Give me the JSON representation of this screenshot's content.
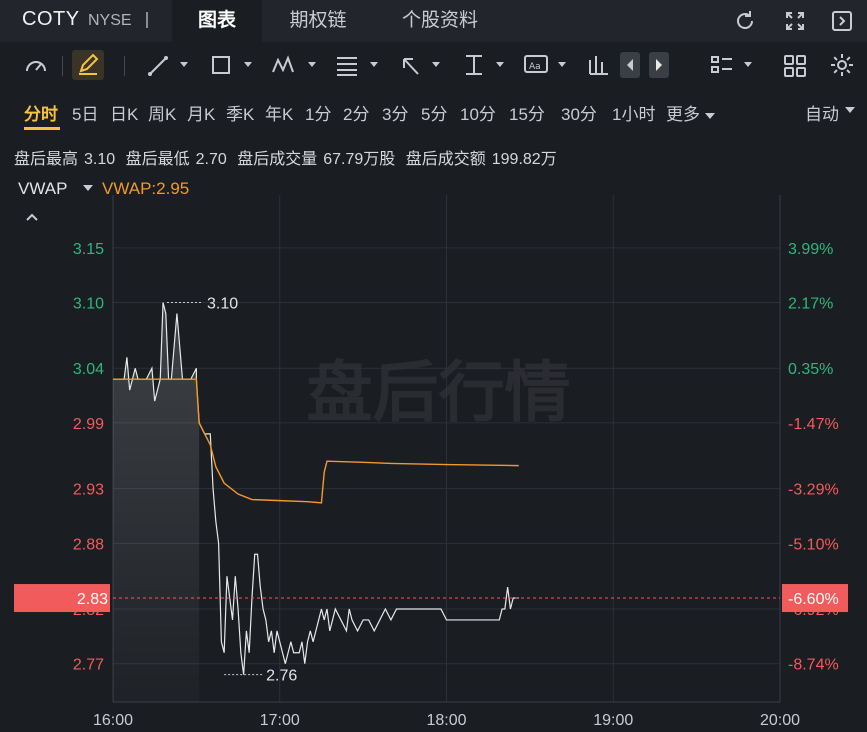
{
  "header": {
    "ticker": "COTY",
    "exchange": "NYSE",
    "tabs": [
      {
        "label": "图表",
        "active": true
      },
      {
        "label": "期权链",
        "active": false
      },
      {
        "label": "个股资料",
        "active": false
      }
    ],
    "icons": [
      "refresh-icon",
      "fullscreen-icon",
      "sidebar-toggle-icon"
    ]
  },
  "toolbar": {
    "icons": [
      "gauge-icon",
      "pen-icon",
      "trendline-icon",
      "rectangle-icon",
      "pattern-icon",
      "fibonacci-icon",
      "arrow-icon",
      "text-height-icon",
      "annotation-icon",
      "candle-bars-icon",
      "prev-arrow-icon",
      "next-arrow-icon",
      "list-settings-icon",
      "grid-layout-icon",
      "settings-icon"
    ],
    "accent": "#f5c242"
  },
  "periods": {
    "items": [
      "分时",
      "5日",
      "日K",
      "周K",
      "月K",
      "季K",
      "年K",
      "1分",
      "2分",
      "3分",
      "5分",
      "10分",
      "15分",
      "30分",
      "1小时",
      "更多"
    ],
    "active": "分时",
    "mode": "自动"
  },
  "stats": {
    "high_label": "盘后最高",
    "high": "3.10",
    "low_label": "盘后最低",
    "low": "2.70",
    "volume_label": "盘后成交量",
    "volume": "67.79万股",
    "amount_label": "盘后成交额",
    "amount": "199.82万"
  },
  "indicator": {
    "name": "VWAP",
    "value_text": "VWAP:2.95",
    "color": "#f19a2a"
  },
  "chart_data": {
    "type": "line",
    "watermark": "盘后行情",
    "x_ticks": [
      "16:00",
      "17:00",
      "18:00",
      "19:00",
      "20:00"
    ],
    "xlim": [
      "16:00",
      "20:00"
    ],
    "ylim": [
      2.735,
      3.18
    ],
    "y_ticks_left": [
      "3.15",
      "3.10",
      "3.04",
      "2.99",
      "2.93",
      "2.88",
      "2.82",
      "2.77"
    ],
    "y_ticks_right": [
      "3.99%",
      "2.17%",
      "0.35%",
      "-1.47%",
      "-3.29%",
      "-5.10%",
      "-6.92%",
      "-8.74%"
    ],
    "y_tick_values": [
      3.15,
      3.1,
      3.04,
      2.99,
      2.93,
      2.88,
      2.82,
      2.77
    ],
    "reference_price": 3.03,
    "up_color": "#2cb87b",
    "down_color": "#f25b5b",
    "current_price": {
      "label": "2.83",
      "pct": "-6.60%",
      "value": 2.83
    },
    "max_annotation": {
      "time": "16:18",
      "value": 3.1,
      "label": "3.10"
    },
    "min_annotation": {
      "time": "16:40",
      "value": 2.76,
      "label": "2.76"
    },
    "series": [
      {
        "name": "price",
        "color": "#e8e8e8",
        "points": [
          [
            "16:00",
            3.03
          ],
          [
            "16:04",
            3.03
          ],
          [
            "16:05",
            3.05
          ],
          [
            "16:06",
            3.02
          ],
          [
            "16:08",
            3.04
          ],
          [
            "16:09",
            3.03
          ],
          [
            "16:10",
            3.03
          ],
          [
            "16:12",
            3.03
          ],
          [
            "16:14",
            3.04
          ],
          [
            "16:15",
            3.01
          ],
          [
            "16:17",
            3.03
          ],
          [
            "16:18",
            3.1
          ],
          [
            "16:19",
            3.09
          ],
          [
            "16:20",
            3.03
          ],
          [
            "16:21",
            3.03
          ],
          [
            "16:23",
            3.09
          ],
          [
            "16:24",
            3.06
          ],
          [
            "16:25",
            3.03
          ],
          [
            "16:28",
            3.03
          ],
          [
            "16:30",
            3.04
          ],
          [
            "16:30",
            3.03
          ],
          [
            "16:31",
            2.99
          ],
          [
            "16:33",
            2.98
          ],
          [
            "16:35",
            2.98
          ],
          [
            "16:36",
            2.93
          ],
          [
            "16:37",
            2.9
          ],
          [
            "16:38",
            2.88
          ],
          [
            "16:39",
            2.79
          ],
          [
            "16:40",
            2.78
          ],
          [
            "16:41",
            2.85
          ],
          [
            "16:42",
            2.83
          ],
          [
            "16:43",
            2.81
          ],
          [
            "16:44",
            2.85
          ],
          [
            "16:45",
            2.82
          ],
          [
            "16:46",
            2.78
          ],
          [
            "16:47",
            2.76
          ],
          [
            "16:48",
            2.8
          ],
          [
            "16:49",
            2.78
          ],
          [
            "16:50",
            2.83
          ],
          [
            "16:51",
            2.87
          ],
          [
            "16:52",
            2.87
          ],
          [
            "16:53",
            2.84
          ],
          [
            "16:54",
            2.82
          ],
          [
            "16:55",
            2.81
          ],
          [
            "16:56",
            2.79
          ],
          [
            "16:57",
            2.8
          ],
          [
            "16:58",
            2.78
          ],
          [
            "16:59",
            2.8
          ],
          [
            "17:00",
            2.79
          ],
          [
            "17:01",
            2.78
          ],
          [
            "17:02",
            2.77
          ],
          [
            "17:03",
            2.78
          ],
          [
            "17:04",
            2.79
          ],
          [
            "17:05",
            2.78
          ],
          [
            "17:07",
            2.78
          ],
          [
            "17:08",
            2.79
          ],
          [
            "17:09",
            2.77
          ],
          [
            "17:10",
            2.79
          ],
          [
            "17:11",
            2.8
          ],
          [
            "17:12",
            2.79
          ],
          [
            "17:13",
            2.8
          ],
          [
            "17:14",
            2.81
          ],
          [
            "17:15",
            2.82
          ],
          [
            "17:16",
            2.81
          ],
          [
            "17:17",
            2.82
          ],
          [
            "17:18",
            2.8
          ],
          [
            "17:19",
            2.81
          ],
          [
            "17:20",
            2.82
          ],
          [
            "17:22",
            2.81
          ],
          [
            "17:24",
            2.8
          ],
          [
            "17:25",
            2.82
          ],
          [
            "17:26",
            2.81
          ],
          [
            "17:28",
            2.8
          ],
          [
            "17:30",
            2.81
          ],
          [
            "17:32",
            2.81
          ],
          [
            "17:34",
            2.8
          ],
          [
            "17:36",
            2.81
          ],
          [
            "17:38",
            2.82
          ],
          [
            "17:40",
            2.81
          ],
          [
            "17:42",
            2.82
          ],
          [
            "17:45",
            2.82
          ],
          [
            "17:48",
            2.82
          ],
          [
            "17:50",
            2.82
          ],
          [
            "17:55",
            2.82
          ],
          [
            "17:56",
            2.82
          ],
          [
            "17:58",
            2.82
          ],
          [
            "18:00",
            2.81
          ],
          [
            "18:05",
            2.81
          ],
          [
            "18:10",
            2.81
          ],
          [
            "18:15",
            2.81
          ],
          [
            "18:19",
            2.81
          ],
          [
            "18:20",
            2.82
          ],
          [
            "18:21",
            2.82
          ],
          [
            "18:22",
            2.84
          ],
          [
            "18:23",
            2.82
          ],
          [
            "18:24",
            2.83
          ],
          [
            "18:26",
            2.83
          ]
        ]
      },
      {
        "name": "VWAP",
        "color": "#f19a2a",
        "points": [
          [
            "16:00",
            3.03
          ],
          [
            "16:30",
            3.03
          ],
          [
            "16:31",
            2.99
          ],
          [
            "16:33",
            2.98
          ],
          [
            "16:35",
            2.97
          ],
          [
            "16:37",
            2.95
          ],
          [
            "16:40",
            2.935
          ],
          [
            "16:45",
            2.925
          ],
          [
            "16:50",
            2.92
          ],
          [
            "17:00",
            2.919
          ],
          [
            "17:10",
            2.918
          ],
          [
            "17:15",
            2.917
          ],
          [
            "17:16",
            2.945
          ],
          [
            "17:17",
            2.955
          ],
          [
            "17:30",
            2.954
          ],
          [
            "17:40",
            2.953
          ],
          [
            "18:00",
            2.952
          ],
          [
            "18:26",
            2.951
          ]
        ]
      }
    ]
  }
}
